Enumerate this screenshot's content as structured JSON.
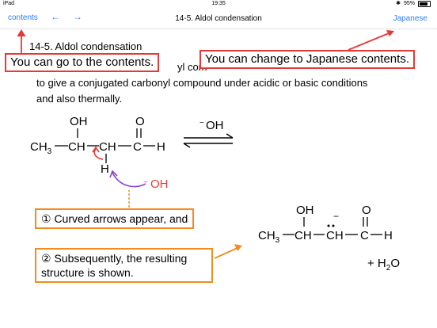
{
  "status_bar": {
    "device": "iPad",
    "wifi": "wifi-icon",
    "time": "19:35",
    "bluetooth": "bluetooth-icon",
    "battery": "95%"
  },
  "nav": {
    "contents_label": "contents",
    "back_arrow": "←",
    "forward_arrow": "→",
    "title": "14-5. Aldol condensation",
    "japanese_label": "Japanese"
  },
  "page": {
    "heading": "14-5. Aldol condensation",
    "line1_visible": "yl com",
    "line2": "to give a conjugated carbonyl compound under acidic or basic conditions",
    "line3": "and also thermally."
  },
  "callouts": {
    "contents": "You can go to the contents.",
    "japanese": "You can change to Japanese contents."
  },
  "notes": {
    "step1": "① Curved arrows appear, and",
    "step2": "② Subsequently, the resulting structure is shown."
  },
  "chem": {
    "OH": "OH",
    "O": "O",
    "CH3": "CH",
    "sub3": "3",
    "CH": "CH",
    "C": "C",
    "H": "H",
    "minus_OH": "OH",
    "minus": "−",
    "plus_h2o": "+ H",
    "sub2": "2",
    "water_O": "O"
  }
}
